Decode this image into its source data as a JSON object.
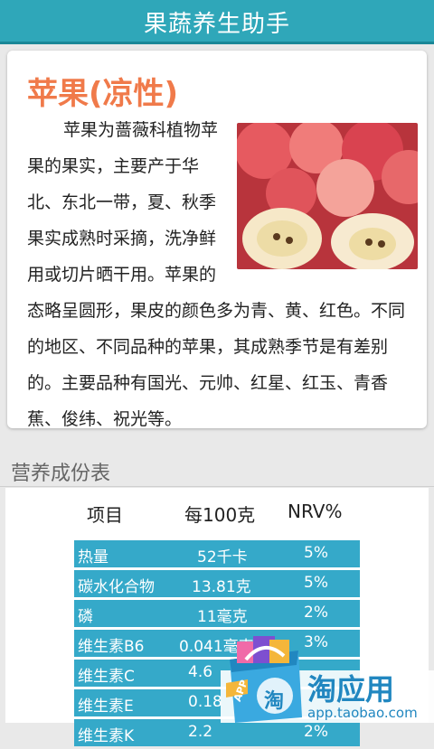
{
  "header": {
    "title": "果蔬养生助手"
  },
  "fruit": {
    "name": "苹果(凉性)",
    "description": "苹果为蔷薇科植物苹果的果实，主要产于华北、东北一带，夏、秋季果实成熟时采摘，洗净鲜用或切片晒干用。苹果的态略呈圆形，果皮的颜色多为青、黄、红色。不同的地区、不同品种的苹果，其成熟季节是有差别的。主要品种有国光、元帅、红星、红玉、青香蕉、俊纬、祝光等。"
  },
  "nutrition": {
    "section_title": "营养成份表",
    "headers": [
      "项目",
      "每100克",
      "NRV%"
    ],
    "rows": [
      {
        "item": "热量",
        "amount": "52千卡",
        "nrv": "5%"
      },
      {
        "item": "碳水化合物",
        "amount": "13.81克",
        "nrv": "5%"
      },
      {
        "item": "磷",
        "amount": "11毫克",
        "nrv": "2%"
      },
      {
        "item": "维生素B6",
        "amount": "0.041毫克",
        "nrv": "3%"
      },
      {
        "item": "维生素C",
        "amount": "4.6",
        "nrv": ""
      },
      {
        "item": "维生素E",
        "amount": "0.18",
        "nrv": ""
      },
      {
        "item": "维生素K",
        "amount": "2.2",
        "nrv": "2%"
      }
    ]
  },
  "ad": {
    "brand": "淘应用",
    "url": "app.taobao.com",
    "badge": "APP",
    "bag_char": "淘"
  },
  "colors": {
    "accent": "#2fa7b9",
    "row": "#35a9c9",
    "title": "#f07a4a"
  }
}
